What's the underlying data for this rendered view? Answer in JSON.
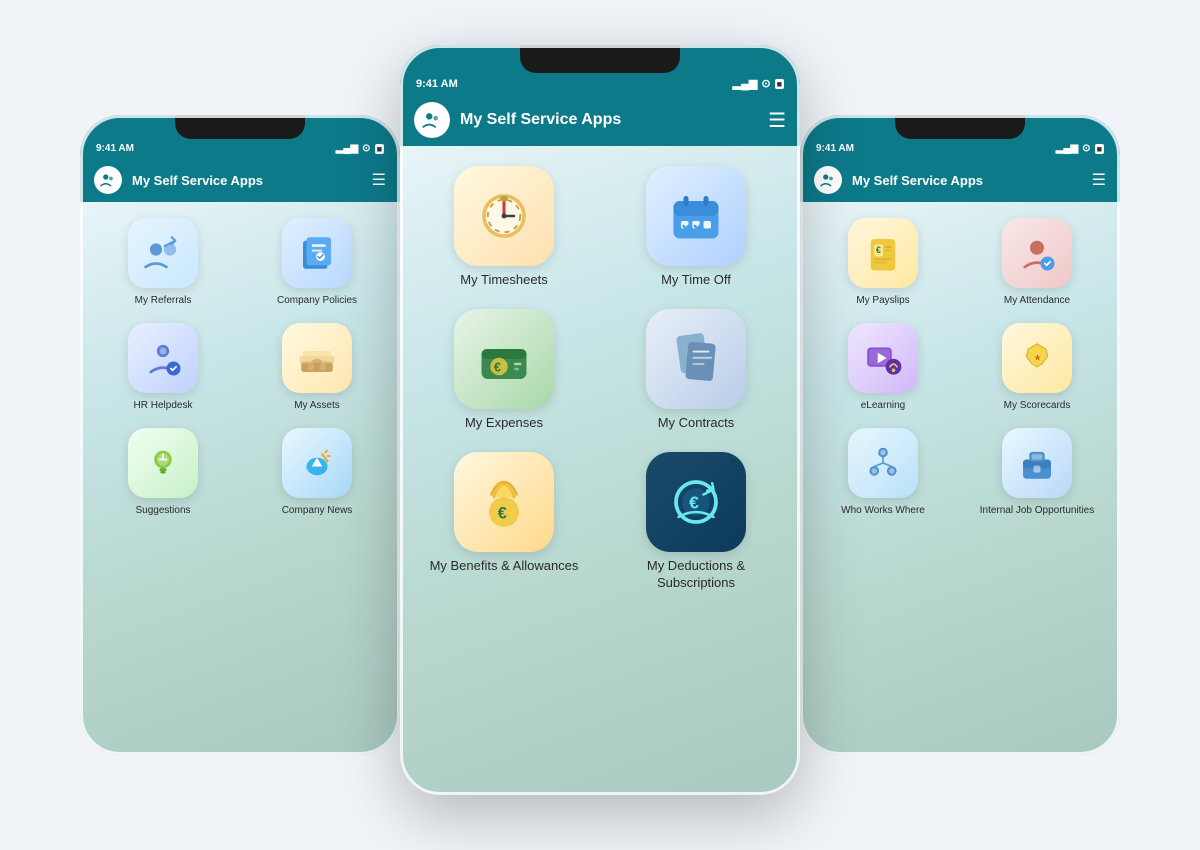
{
  "phones": {
    "left": {
      "status": {
        "time": "9:41 AM",
        "signal": "▂▄▆",
        "wifi": "WiFi",
        "battery": "▓▓▓"
      },
      "nav": {
        "title": "My Self Service Apps",
        "logo": "U"
      },
      "apps": [
        {
          "id": "referrals",
          "label": "My Referrals",
          "iconClass": "icon-referrals",
          "emoji": "referrals"
        },
        {
          "id": "policies",
          "label": "Company Policies",
          "iconClass": "icon-policies",
          "emoji": "policies"
        },
        {
          "id": "hr",
          "label": "HR Helpdesk",
          "iconClass": "icon-hr",
          "emoji": "hr"
        },
        {
          "id": "assets",
          "label": "My Assets",
          "iconClass": "icon-assets",
          "emoji": "assets"
        },
        {
          "id": "suggestions",
          "label": "Suggestions",
          "iconClass": "icon-suggestions",
          "emoji": "suggestions"
        },
        {
          "id": "news",
          "label": "Company News",
          "iconClass": "icon-news",
          "emoji": "news"
        }
      ]
    },
    "center": {
      "status": {
        "time": "9:41 AM",
        "signal": "▂▄▆",
        "wifi": "WiFi",
        "battery": "▓▓▓"
      },
      "nav": {
        "title": "My Self Service Apps",
        "logo": "U"
      },
      "apps": [
        {
          "id": "timesheets",
          "label": "My Timesheets",
          "iconClass": "icon-timesheets",
          "emoji": "timesheets"
        },
        {
          "id": "timeoff",
          "label": "My Time Off",
          "iconClass": "icon-timeoff",
          "emoji": "timeoff"
        },
        {
          "id": "expenses",
          "label": "My Expenses",
          "iconClass": "icon-expenses",
          "emoji": "expenses"
        },
        {
          "id": "contracts",
          "label": "My Contracts",
          "iconClass": "icon-contracts",
          "emoji": "contracts"
        },
        {
          "id": "benefits",
          "label": "My Benefits & Allowances",
          "iconClass": "icon-benefits",
          "emoji": "benefits"
        },
        {
          "id": "deductions",
          "label": "My Deductions & Subscriptions",
          "iconClass": "icon-deductions",
          "emoji": "deductions"
        }
      ]
    },
    "right": {
      "status": {
        "time": "9:41 AM",
        "signal": "▂▄▆",
        "wifi": "WiFi",
        "battery": "▓▓▓"
      },
      "nav": {
        "title": "My Self Service Apps",
        "logo": "U"
      },
      "apps": [
        {
          "id": "payslips",
          "label": "My Payslips",
          "iconClass": "icon-payslips",
          "emoji": "payslips"
        },
        {
          "id": "attendance",
          "label": "My Attendance",
          "iconClass": "icon-attendance",
          "emoji": "attendance"
        },
        {
          "id": "elearning",
          "label": "eLearning",
          "iconClass": "icon-elearning",
          "emoji": "elearning"
        },
        {
          "id": "scorecards",
          "label": "My Scorecards",
          "iconClass": "icon-scorecards",
          "emoji": "scorecards"
        },
        {
          "id": "whoworks",
          "label": "Who Works Where",
          "iconClass": "icon-whoworks",
          "emoji": "whoworks"
        },
        {
          "id": "jobs",
          "label": "Internal Job Opportunities",
          "iconClass": "icon-jobs",
          "emoji": "jobs"
        }
      ]
    }
  },
  "colors": {
    "navBg": "#0d7a8a",
    "contentBg1": "#e8f4f8",
    "contentBg2": "#a8c8c0"
  }
}
